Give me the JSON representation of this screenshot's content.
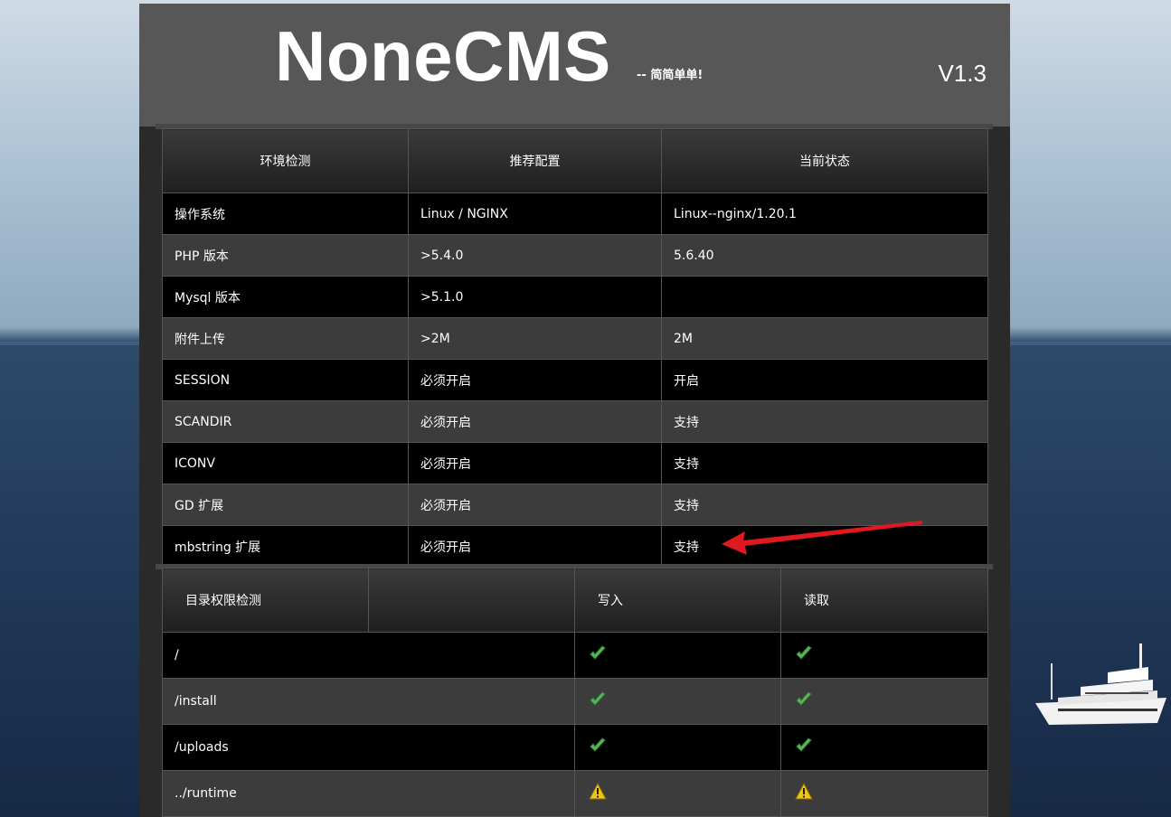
{
  "header": {
    "logo": "NoneCMS",
    "slogan": "-- 简简单单!",
    "version": "V1.3"
  },
  "env_table": {
    "headers": [
      "环境检测",
      "推荐配置",
      "当前状态"
    ],
    "rows": [
      [
        "操作系统",
        "Linux / NGINX",
        "Linux--nginx/1.20.1"
      ],
      [
        "PHP 版本",
        ">5.4.0",
        "5.6.40"
      ],
      [
        "Mysql 版本",
        ">5.1.0",
        ""
      ],
      [
        "附件上传",
        ">2M",
        "2M"
      ],
      [
        "SESSION",
        "必须开启",
        "开启"
      ],
      [
        "SCANDIR",
        "必须开启",
        "支持"
      ],
      [
        "ICONV",
        "必须开启",
        "支持"
      ],
      [
        "GD 扩展",
        "必须开启",
        "支持"
      ],
      [
        "mbstring 扩展",
        "必须开启",
        "支持"
      ]
    ]
  },
  "dir_table": {
    "headers": [
      "目录权限检测",
      "",
      "写入",
      "读取"
    ],
    "rows": [
      {
        "path": "/",
        "write": "ok-icon",
        "read": "ok-icon"
      },
      {
        "path": "/install",
        "write": "ok-icon",
        "read": "ok-icon"
      },
      {
        "path": "/uploads",
        "write": "ok-icon",
        "read": "ok-icon"
      },
      {
        "path": "../runtime",
        "write": "warning-icon",
        "read": "warning-icon"
      }
    ]
  },
  "colors": {
    "ok": "#5cb85c",
    "warning": "#f0c419",
    "annotation_arrow": "#e0181f"
  }
}
